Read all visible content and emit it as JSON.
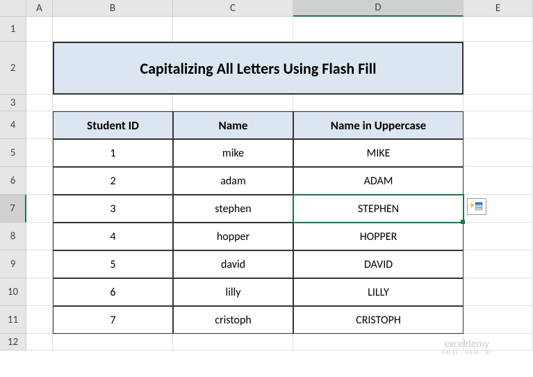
{
  "columns": [
    "A",
    "B",
    "C",
    "D",
    "E"
  ],
  "rows": [
    "1",
    "2",
    "3",
    "4",
    "5",
    "6",
    "7",
    "8",
    "9",
    "10",
    "11",
    "12"
  ],
  "activeColumn": "D",
  "activeRow": "7",
  "title": "Capitalizing All Letters Using Flash Fill",
  "headers": {
    "studentId": "Student ID",
    "name": "Name",
    "uppercase": "Name in Uppercase"
  },
  "data": [
    {
      "id": "1",
      "name": "mike",
      "upper": "MIKE"
    },
    {
      "id": "2",
      "name": "adam",
      "upper": "ADAM"
    },
    {
      "id": "3",
      "name": "stephen",
      "upper": "STEPHEN"
    },
    {
      "id": "4",
      "name": "hopper",
      "upper": "HOPPER"
    },
    {
      "id": "5",
      "name": "david",
      "upper": "DAVID"
    },
    {
      "id": "6",
      "name": "lilly",
      "upper": "LILLY"
    },
    {
      "id": "7",
      "name": "cristoph",
      "upper": "CRISTOPH"
    }
  ],
  "watermark": {
    "main": "exceldemy",
    "sub": "EXCEL · DATA · BI"
  }
}
